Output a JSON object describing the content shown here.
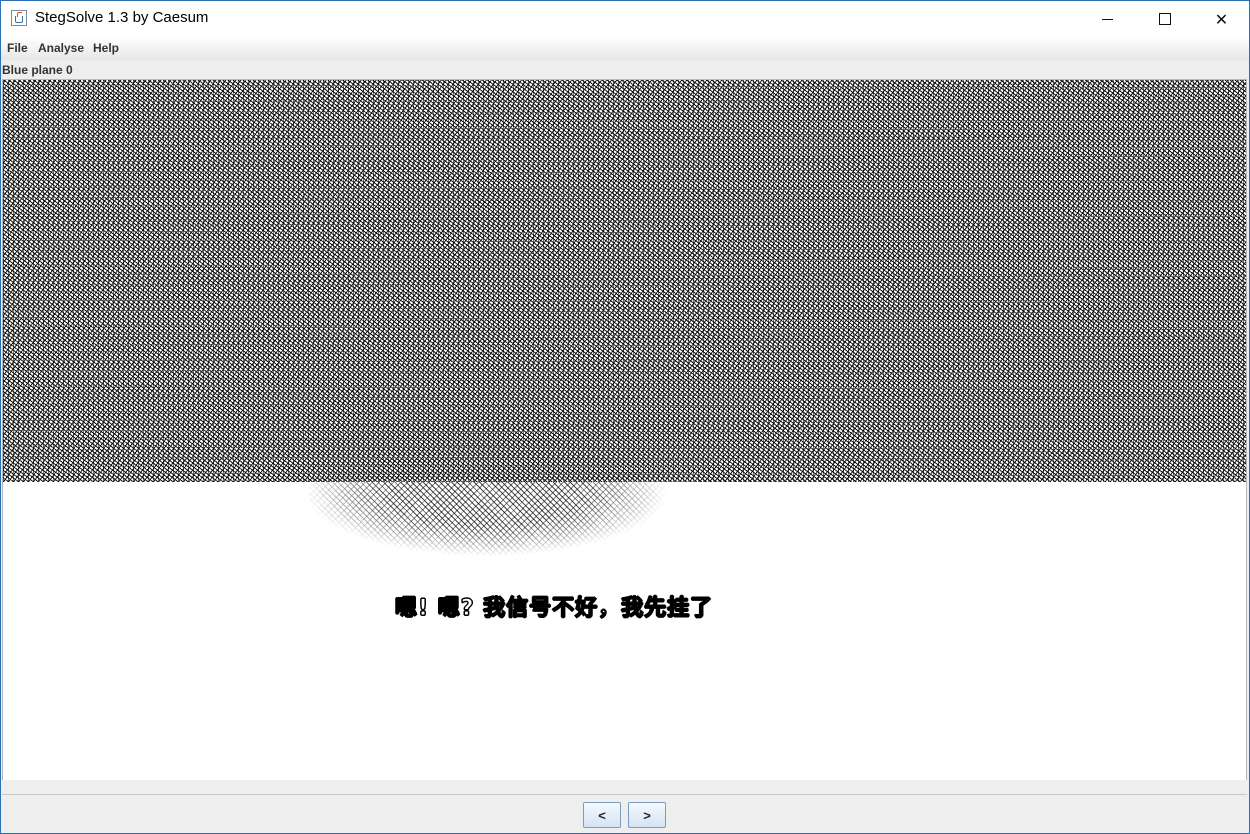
{
  "window": {
    "title": "StegSolve 1.3 by Caesum",
    "controls": {
      "minimize_icon": "minimize-icon",
      "maximize_icon": "maximize-icon",
      "close_icon": "close-icon"
    },
    "close_glyph": "✕"
  },
  "menu": {
    "items": [
      {
        "label": "File"
      },
      {
        "label": "Analyse"
      },
      {
        "label": "Help"
      }
    ]
  },
  "viewer": {
    "plane_label": "Blue plane 0",
    "hidden_text": "嗯! 嗯? 我信号不好，我先挂了"
  },
  "navigation": {
    "prev_label": "<",
    "next_label": ">"
  },
  "colors": {
    "window_border": "#2b6fb6",
    "background": "#eeeeee",
    "button_border": "#7a9cc4"
  }
}
